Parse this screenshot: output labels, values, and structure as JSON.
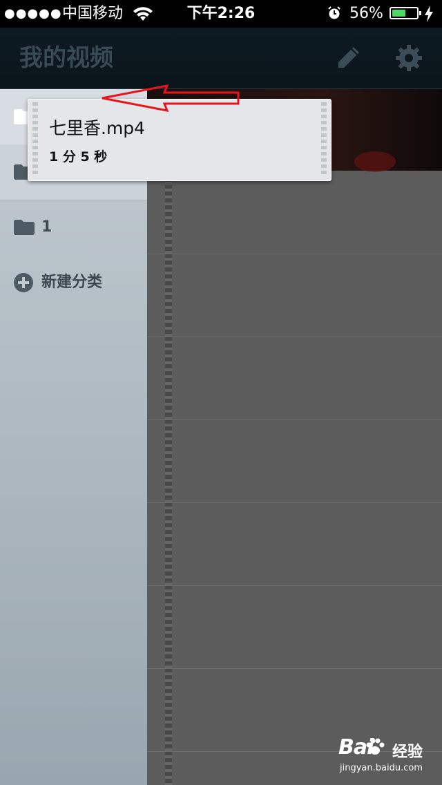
{
  "status_bar": {
    "signal": "●●●●●",
    "carrier": "中国移动",
    "time": "下午2:26",
    "battery_percent": "56%",
    "battery_level": 0.56,
    "battery_color": "#4cd964"
  },
  "nav": {
    "title": "我的视频",
    "edit_icon": "pencil-icon",
    "settings_icon": "gear-icon"
  },
  "sidebar": {
    "items": [
      {
        "label": "",
        "icon": "folder-icon"
      },
      {
        "label": "",
        "icon": "folder-icon"
      },
      {
        "label": "1",
        "icon": "folder-icon"
      },
      {
        "label": "新建分类",
        "icon": "plus-circle-icon"
      }
    ]
  },
  "popup": {
    "filename": "七里香.mp4",
    "duration": "1 分 5 秒"
  },
  "annotation": {
    "arrow_color": "#e8141c"
  },
  "watermark": {
    "logo": "Bai",
    "logo_suffix": "经验",
    "url": "jingyan.baidu.com"
  }
}
